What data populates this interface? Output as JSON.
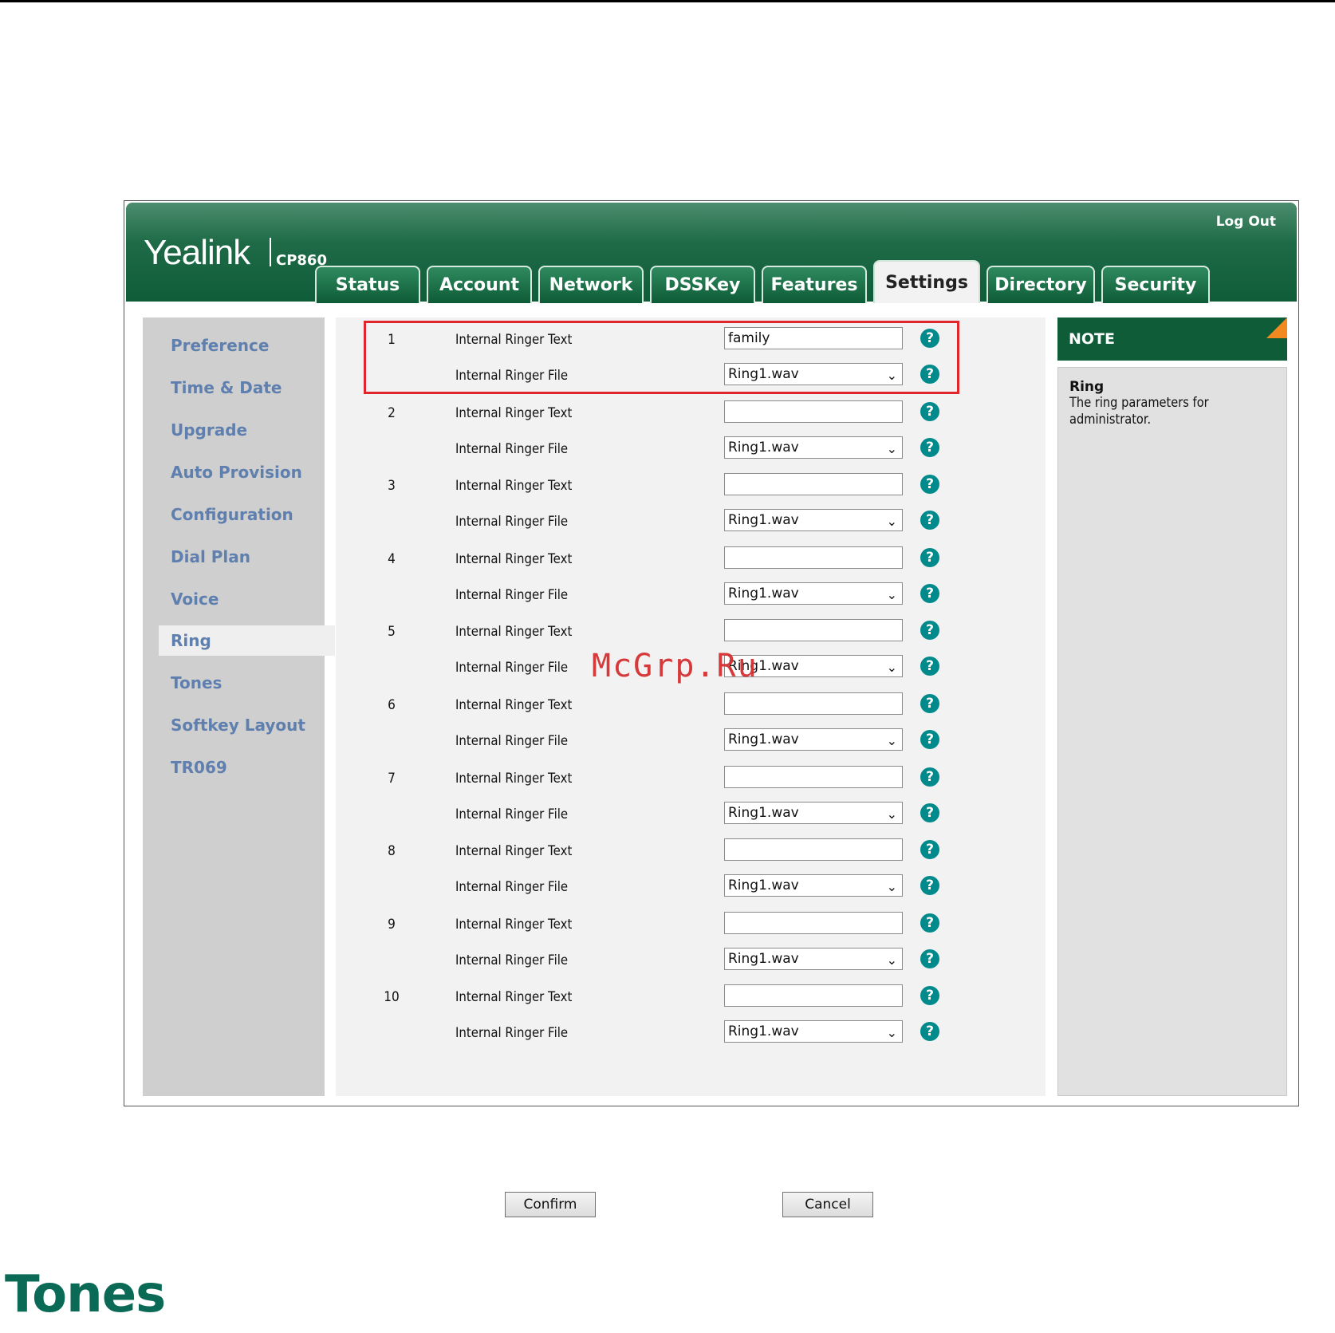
{
  "header": {
    "brand": "Yealink",
    "model": "CP860",
    "logout_label": "Log Out"
  },
  "tabs": [
    {
      "label": "Status"
    },
    {
      "label": "Account"
    },
    {
      "label": "Network"
    },
    {
      "label": "DSSKey"
    },
    {
      "label": "Features"
    },
    {
      "label": "Settings",
      "active": true
    },
    {
      "label": "Directory"
    },
    {
      "label": "Security"
    }
  ],
  "sidebar": {
    "items": [
      {
        "label": "Preference"
      },
      {
        "label": "Time & Date"
      },
      {
        "label": "Upgrade"
      },
      {
        "label": "Auto Provision"
      },
      {
        "label": "Configuration"
      },
      {
        "label": "Dial Plan"
      },
      {
        "label": "Voice"
      },
      {
        "label": "Ring",
        "active": true
      },
      {
        "label": "Tones"
      },
      {
        "label": "Softkey Layout"
      },
      {
        "label": "TR069"
      }
    ]
  },
  "ringers": [
    {
      "num": "1",
      "text_label": "Internal Ringer Text",
      "text_value": "family",
      "file_label": "Internal Ringer File",
      "file_value": "Ring1.wav"
    },
    {
      "num": "2",
      "text_label": "Internal Ringer Text",
      "text_value": "",
      "file_label": "Internal Ringer File",
      "file_value": "Ring1.wav"
    },
    {
      "num": "3",
      "text_label": "Internal Ringer Text",
      "text_value": "",
      "file_label": "Internal Ringer File",
      "file_value": "Ring1.wav"
    },
    {
      "num": "4",
      "text_label": "Internal Ringer Text",
      "text_value": "",
      "file_label": "Internal Ringer File",
      "file_value": "Ring1.wav"
    },
    {
      "num": "5",
      "text_label": "Internal Ringer Text",
      "text_value": "",
      "file_label": "Internal Ringer File",
      "file_value": "Ring1.wav"
    },
    {
      "num": "6",
      "text_label": "Internal Ringer Text",
      "text_value": "",
      "file_label": "Internal Ringer File",
      "file_value": "Ring1.wav"
    },
    {
      "num": "7",
      "text_label": "Internal Ringer Text",
      "text_value": "",
      "file_label": "Internal Ringer File",
      "file_value": "Ring1.wav"
    },
    {
      "num": "8",
      "text_label": "Internal Ringer Text",
      "text_value": "",
      "file_label": "Internal Ringer File",
      "file_value": "Ring1.wav"
    },
    {
      "num": "9",
      "text_label": "Internal Ringer Text",
      "text_value": "",
      "file_label": "Internal Ringer File",
      "file_value": "Ring1.wav"
    },
    {
      "num": "10",
      "text_label": "Internal Ringer Text",
      "text_value": "",
      "file_label": "Internal Ringer File",
      "file_value": "Ring1.wav"
    }
  ],
  "buttons": {
    "confirm": "Confirm",
    "cancel": "Cancel"
  },
  "note": {
    "heading": "NOTE",
    "title": "Ring",
    "text": "The ring parameters for administrator."
  },
  "help_glyph": "?",
  "select_chevron": "⌄",
  "watermark": "McGrp.Ru",
  "section_title": "Tones",
  "colors": {
    "header_green": "#0f5c38",
    "sidebar_link": "#5f7fae",
    "help_teal": "#008a8c",
    "highlight_red": "#e0262b",
    "note_corner": "#f28a21",
    "section_title": "#0a6a55"
  }
}
